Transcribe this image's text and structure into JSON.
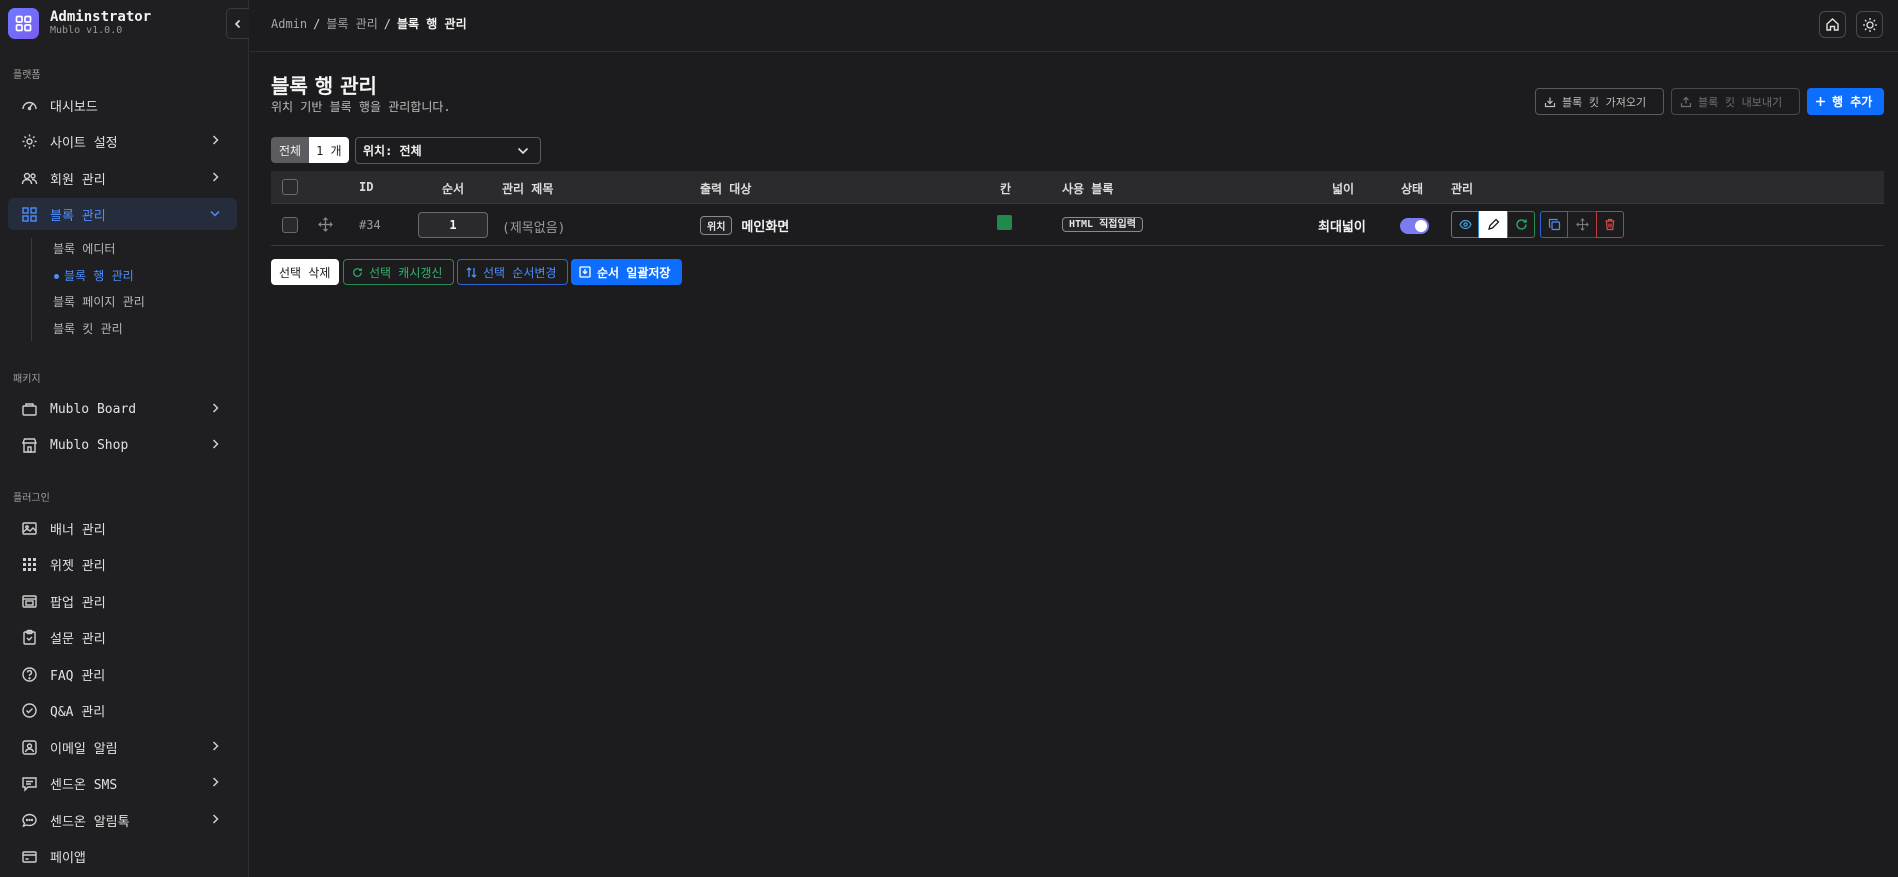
{
  "app": {
    "name": "Adminstrator",
    "version": "Mublo v1.0.0"
  },
  "sidebar": {
    "sections": {
      "platform": "플랫폼",
      "package": "패키지",
      "plugin": "플러그인"
    },
    "platform_items": [
      {
        "label": "대시보드",
        "icon": "dashboard-icon"
      },
      {
        "label": "사이트 설정",
        "icon": "gear-icon"
      },
      {
        "label": "회원 관리",
        "icon": "users-icon"
      },
      {
        "label": "블록 관리",
        "icon": "grid-icon"
      }
    ],
    "block_sub": [
      {
        "label": "블록 에디터"
      },
      {
        "label": "블록 행 관리"
      },
      {
        "label": "블록 페이지 관리"
      },
      {
        "label": "블록 킷 관리"
      }
    ],
    "package_items": [
      {
        "label": "Mublo Board",
        "icon": "box-icon"
      },
      {
        "label": "Mublo Shop",
        "icon": "store-icon"
      }
    ],
    "plugin_items": [
      {
        "label": "배너 관리",
        "icon": "image-icon"
      },
      {
        "label": "위젯 관리",
        "icon": "widget-icon"
      },
      {
        "label": "팝업 관리",
        "icon": "popup-icon"
      },
      {
        "label": "설문 관리",
        "icon": "clipboard-icon"
      },
      {
        "label": "FAQ 관리",
        "icon": "question-icon"
      },
      {
        "label": "Q&A 관리",
        "icon": "check-circle-icon"
      },
      {
        "label": "이메일 알림",
        "icon": "mail-icon"
      },
      {
        "label": "센드온 SMS",
        "icon": "message-icon"
      },
      {
        "label": "센드온 알림톡",
        "icon": "chat-icon"
      },
      {
        "label": "페이앱",
        "icon": "card-icon"
      }
    ]
  },
  "breadcrumb": {
    "root": "Admin",
    "sep": "/",
    "parent": "블록 관리",
    "current": "블록 행 관리"
  },
  "page": {
    "title": "블록 행 관리",
    "description": "위치 기반 블록 행을 관리합니다.",
    "buttons": {
      "import_kit": "블록 킷 가져오기",
      "export_kit": "블록 킷 내보내기",
      "add_row": "행 추가"
    }
  },
  "filter": {
    "count_label": "전체",
    "count_value": "1 개",
    "position_select": "위치: 전체"
  },
  "table": {
    "headers": {
      "id": "ID",
      "order": "순서",
      "title": "관리 제목",
      "target": "출력 대상",
      "columns": "칸",
      "blocks": "사용 블록",
      "width": "넓이",
      "status": "상태",
      "manage": "관리"
    },
    "rows": [
      {
        "id": "#34",
        "order": "1",
        "title": "(제목없음)",
        "target_badge": "위치",
        "target": "메인화면",
        "column_color": "#1f8a4c",
        "block_badge": "HTML 직접입력",
        "width": "최대넓이",
        "status_on": true
      }
    ]
  },
  "bulk": {
    "delete": "선택 삭제",
    "refresh_cache": "선택 캐시갱신",
    "change_order": "선택 순서변경",
    "save_order": "순서 일괄저장"
  },
  "colors": {
    "accent": "#0d6efd",
    "active_text": "#4d8dff",
    "success": "#2fb36b",
    "danger": "#e5484d"
  }
}
